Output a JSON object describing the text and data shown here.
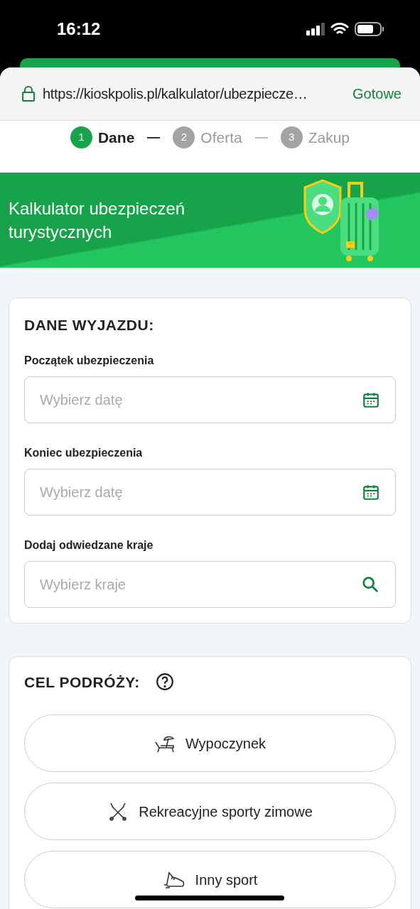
{
  "status_bar": {
    "time": "16:12"
  },
  "browser": {
    "url": "https://kioskpolis.pl/kalkulator/ubezpiecze…",
    "done": "Gotowe"
  },
  "steps": [
    {
      "number": "1",
      "label": "Dane",
      "selected": true
    },
    {
      "number": "2",
      "label": "Oferta",
      "selected": false
    },
    {
      "number": "3",
      "label": "Zakup",
      "selected": false
    }
  ],
  "banner": {
    "title": "Kalkulator ubezpieczeń turystycznych"
  },
  "trip": {
    "heading": "DANE WYJAZDU:",
    "fields": [
      {
        "kind": "date",
        "label": "Początek ubezpieczenia",
        "placeholder": "Wybierz datę"
      },
      {
        "kind": "date",
        "label": "Koniec ubezpieczenia",
        "placeholder": "Wybierz datę"
      },
      {
        "kind": "search",
        "label": "Dodaj odwiedzane kraje",
        "placeholder": "Wybierz kraje"
      }
    ]
  },
  "purpose": {
    "heading": "CEL PODRÓŻY:",
    "options": [
      {
        "kind": "lounger",
        "label": "Wypoczynek",
        "selected": false
      },
      {
        "kind": "ski",
        "label": "Rekreacyjne sporty zimowe",
        "selected": false
      },
      {
        "kind": "shoe",
        "label": "Inny sport",
        "selected": false
      }
    ]
  }
}
